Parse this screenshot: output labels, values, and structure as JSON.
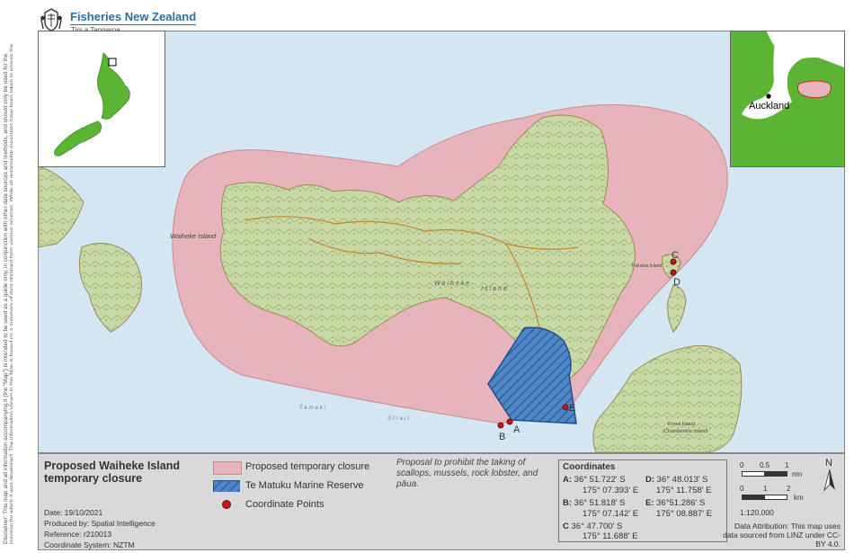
{
  "header": {
    "org_name": "Fisheries New Zealand",
    "org_subtitle": "Tini a Tangaroa"
  },
  "disclaimer": "Disclaimer: This map and all information accompanying it (the “Map”) is intended to be used as a guide only, in conjunction with other data sources and methods, and should only be used for the purpose for which it was developed. The information shown in this Map is based on a summary of data obtained from various sources. While all reasonable measures have been taken to ensure the accuracy of the Map, MPI: (a) gives no warranty or representation in relation to the accuracy, completeness, reliability or fitness for purpose of the Map; and (b) accepts no liability whatsoever in relation to any loss, damage or other costs relating to any person’s use of the Map, including but not limited to any compilations, derivative works or modifications of the Map. Crown copyright © This map is subject to Crown copyright administered by Ministry for Primary Industries (MPI).",
  "map": {
    "island_label": "Waiheke Island",
    "island_label_2": "Waiheke",
    "island_label_3": "Island",
    "pakatoa_label": "Pakatoa Island",
    "ponui_label": "Ponui Island",
    "ponui_sub": "(Chamberlins Island)",
    "strait_1": "Tamaki",
    "strait_2": "Strait",
    "point_labels": [
      "A",
      "B",
      "C",
      "D",
      "E"
    ]
  },
  "insets": {
    "auckland_label": "Auckland"
  },
  "legend": {
    "title": "Proposed Waiheke Island temporary closure",
    "date": "Date: 19/10/2021",
    "produced_by": "Produced by: Spatial Intelligence",
    "reference": "Reference: r210013",
    "coordinate_system": "Coordinate System: NZTM",
    "items": [
      {
        "label": "Proposed temporary closure",
        "color": "#e8b4bc"
      },
      {
        "label": "Te Matuku Marine Reserve",
        "color": "#4f86c6"
      },
      {
        "label": "Coordinate Points",
        "color": "#c0191c"
      }
    ],
    "proposal_text": "Proposal to prohibit the taking of scallops, mussels, rock lobster, and pāua.",
    "coordinates_title": "Coordinates",
    "coordinates": [
      {
        "key": "A:",
        "lat": "36° 51.722' S",
        "lon": "175° 07.393' E"
      },
      {
        "key": "B:",
        "lat": "36° 51.818' S",
        "lon": "175° 07.142' E"
      },
      {
        "key": "C",
        "lat": "36° 47.700' S",
        "lon": "175° 11.688' E"
      },
      {
        "key": "D:",
        "lat": "36° 48.013' S",
        "lon": "175° 11.758' E"
      },
      {
        "key": "E:",
        "lat": "36°51.286' S",
        "lon": "175° 08.887' E"
      }
    ],
    "scale_nm": {
      "ticks": [
        "0",
        "0.5",
        "1"
      ],
      "unit": "nm"
    },
    "scale_km": {
      "ticks": [
        "0",
        "1",
        "2"
      ],
      "unit": "km"
    },
    "scale_ratio": "1:120,000",
    "north_label": "N",
    "attribution": "Data Attribution: This map uses data sourced from LINZ under CC-BY 4.0."
  }
}
